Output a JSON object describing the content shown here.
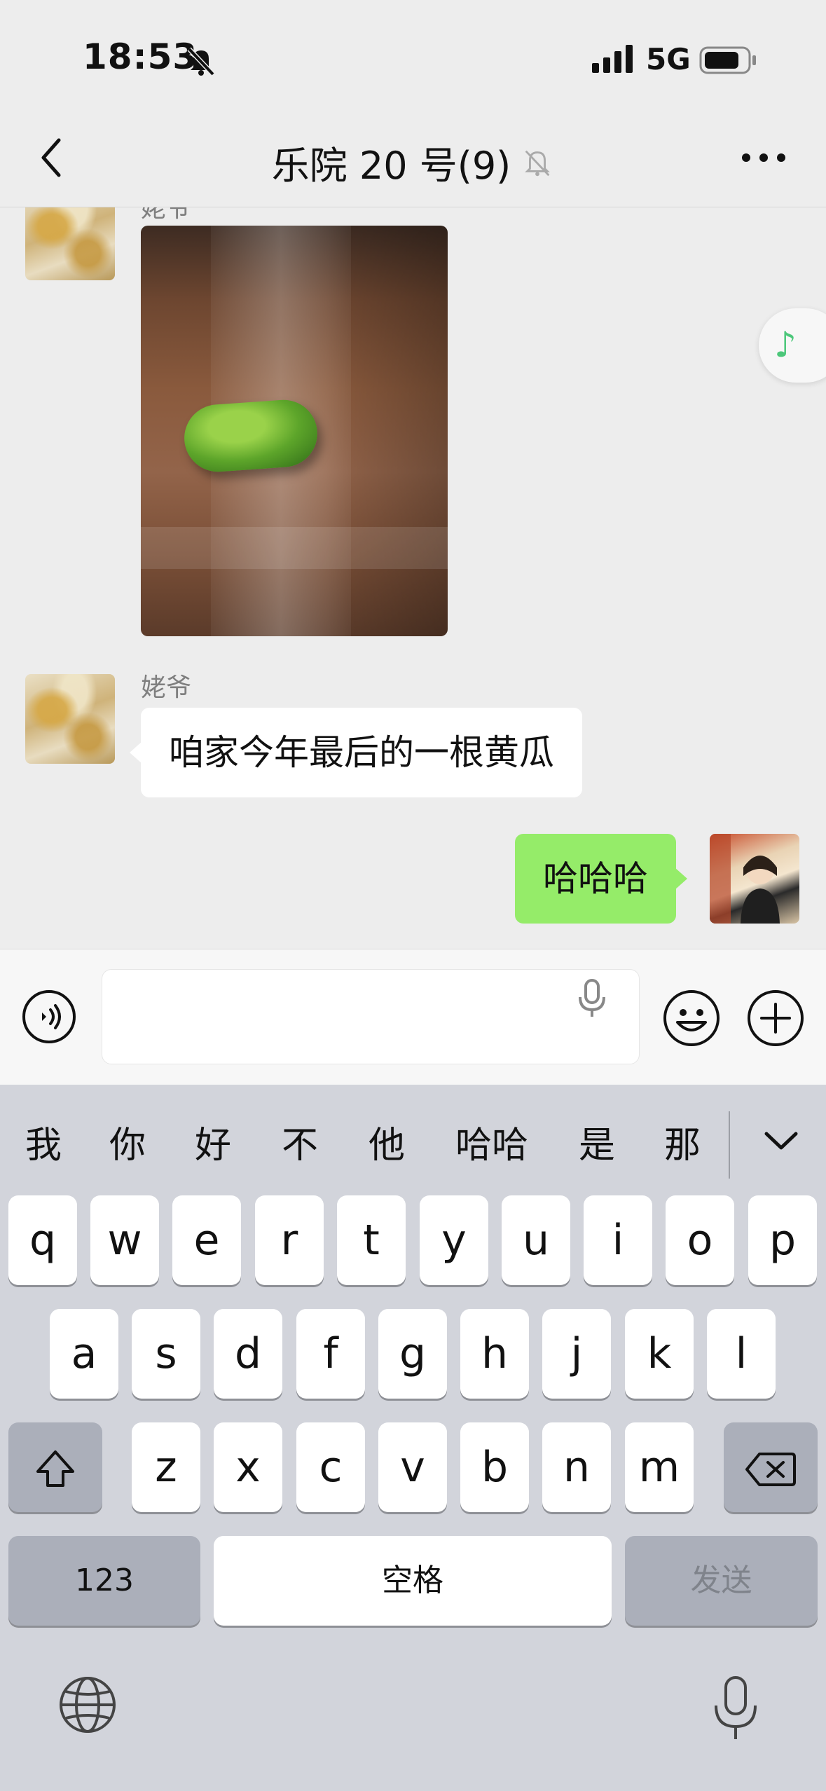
{
  "status_bar": {
    "time": "18:53",
    "network": "5G",
    "icons": [
      "bell-slash-icon",
      "signal-icon",
      "battery-icon"
    ]
  },
  "nav": {
    "title": "乐院 20 号(9)",
    "icons": [
      "back-chevron-icon",
      "bell-slash-icon",
      "more-dots-icon"
    ]
  },
  "messages": [
    {
      "type": "image",
      "side": "left",
      "sender": "姥爷",
      "image_alt": "cucumber photo"
    },
    {
      "type": "text",
      "side": "left",
      "sender": "姥爷",
      "text": "咱家今年最后的一根黄瓜"
    },
    {
      "type": "text",
      "side": "right",
      "text": "哈哈哈"
    }
  ],
  "floating": {
    "icon": "music-note-icon"
  },
  "input_bar": {
    "value": "",
    "icons": [
      "voice-icon",
      "mic-icon",
      "emoji-icon",
      "plus-icon"
    ]
  },
  "keyboard": {
    "candidates": [
      "我",
      "你",
      "好",
      "不",
      "他",
      "哈哈",
      "是",
      "那"
    ],
    "row1": [
      "q",
      "w",
      "e",
      "r",
      "t",
      "y",
      "u",
      "i",
      "o",
      "p"
    ],
    "row2": [
      "a",
      "s",
      "d",
      "f",
      "g",
      "h",
      "j",
      "k",
      "l"
    ],
    "row3": [
      "z",
      "x",
      "c",
      "v",
      "b",
      "n",
      "m"
    ],
    "numbers_key": "123",
    "space_key": "空格",
    "send_key": "发送",
    "icons": [
      "chevron-down-icon",
      "shift-icon",
      "delete-icon",
      "globe-icon",
      "microphone-icon"
    ]
  },
  "colors": {
    "background": "#ededed",
    "my_bubble": "#95ec69",
    "their_bubble": "#ffffff",
    "keyboard_bg": "#d2d4db",
    "accent_music": "#4cc77a"
  }
}
